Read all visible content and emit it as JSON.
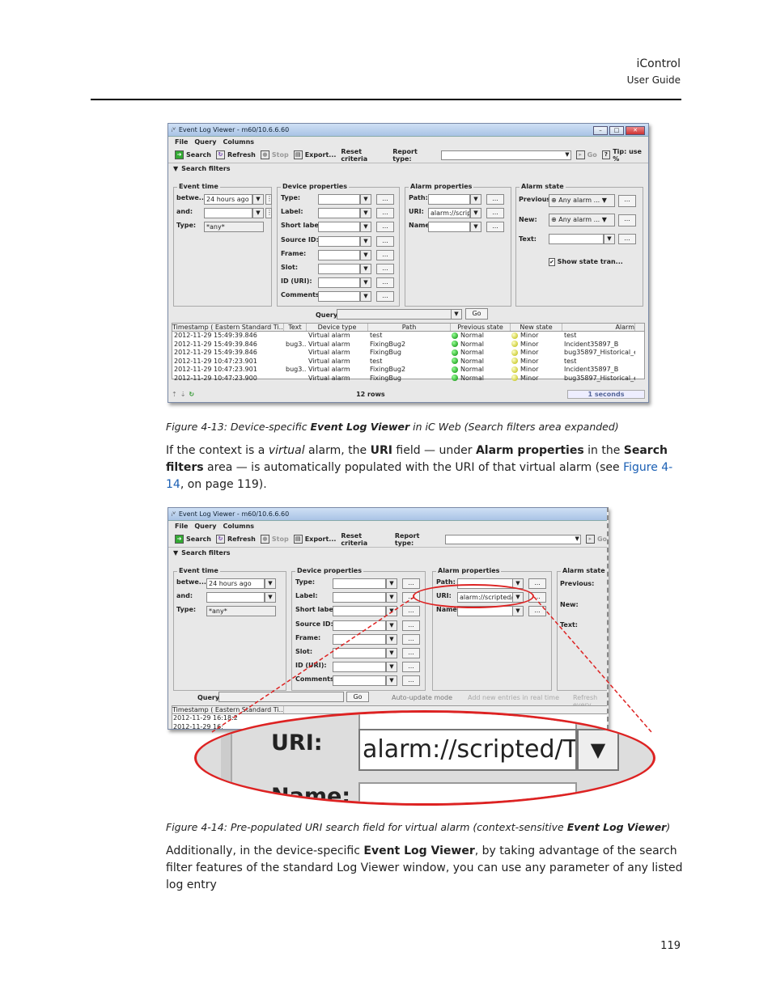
{
  "header": {
    "title": "iControl",
    "subtitle": "User Guide"
  },
  "page_number": "119",
  "fig13": {
    "window_title": "Event Log Viewer - m60/10.6.6.60",
    "menu": [
      "File",
      "Query",
      "Columns"
    ],
    "toolbar": {
      "search": "Search",
      "refresh": "Refresh",
      "stop": "Stop",
      "export": "Export...",
      "reset": "Reset criteria",
      "report_type": "Report type:",
      "go": "Go",
      "tip": "Tip: use %"
    },
    "search_filters": "Search filters",
    "event_time": {
      "title": "Event time",
      "between": "betwe...",
      "between_value": "24 hours ago",
      "and": "and:",
      "type": "Type:",
      "type_value": "*any*"
    },
    "device_properties": {
      "title": "Device properties",
      "labels": [
        "Type:",
        "Label:",
        "Short label:",
        "Source ID:",
        "Frame:",
        "Slot:",
        "ID (URI):",
        "Comments:"
      ]
    },
    "alarm_properties": {
      "title": "Alarm properties",
      "path": "Path:",
      "uri": "URI:",
      "uri_value": "alarm://script",
      "name": "Name:"
    },
    "alarm_state": {
      "title": "Alarm state",
      "previous": "Previous:",
      "new": "New:",
      "text": "Text:",
      "any_alarm": "Any alarm ...",
      "show_state": "Show state tran..."
    },
    "query": "Query:",
    "query_go": "Go",
    "table": {
      "headers": [
        "Timestamp ( Eastern Standard Ti...",
        "Text",
        "Device type",
        "Path",
        "Previous state",
        "New state",
        "Alarm"
      ],
      "rows": [
        [
          "2012-11-29 15:49:39.846",
          "",
          "Virtual alarm",
          "test",
          "Normal",
          "Minor",
          "test"
        ],
        [
          "2012-11-29 15:49:39.846",
          "bug3...",
          "Virtual alarm",
          "FixingBug2",
          "Normal",
          "Minor",
          "Incident35897_B"
        ],
        [
          "2012-11-29 15:49:39.846",
          "",
          "Virtual alarm",
          "FixingBug",
          "Normal",
          "Minor",
          "bug35897_Historical_e"
        ],
        [
          "2012-11-29 10:47:23.901",
          "",
          "Virtual alarm",
          "test",
          "Normal",
          "Minor",
          "test"
        ],
        [
          "2012-11-29 10:47:23.901",
          "bug3...",
          "Virtual alarm",
          "FixingBug2",
          "Normal",
          "Minor",
          "Incident35897_B"
        ],
        [
          "2012-11-29 10:47:23.900",
          "",
          "Virtual alarm",
          "FixingBug",
          "Normal",
          "Minor",
          "bug35897_Historical_e"
        ]
      ]
    },
    "rows_count": "12 rows",
    "elapsed": "1 seconds"
  },
  "caption13": {
    "prefix": "Figure 4-13:  Device-specific ",
    "bold": "Event Log Viewer",
    "suffix": " in iC Web (Search filters area expanded)"
  },
  "para1": {
    "t1": "If the context is a ",
    "t2": "virtual",
    "t3": " alarm, the ",
    "t4": "URI",
    "t5": " field — under ",
    "t6": "Alarm properties",
    "t7": " in the ",
    "t8": "Search filters",
    "t9": " area — is automatically populated with the URI of that virtual alarm (see ",
    "link": "Figure 4-14",
    "t10": ",  on page 119)."
  },
  "fig14": {
    "window_title": "Event Log Viewer - m60/10.6.6.60",
    "uri_value": "alarm://scripted/T",
    "query_extra": {
      "auto_update": "Auto-update mode",
      "add_new": "Add new entries in real time",
      "refresh": "Refresh every"
    },
    "row1": "2012-11-29 16:18:2",
    "row2": "2012-11-29 16:",
    "zoom": {
      "uri": "URI:",
      "value": "alarm://scripted/T",
      "name": "Name:"
    }
  },
  "caption14": {
    "prefix": "Figure 4-14:  Pre-populated URI search field for virtual alarm (context-sensitive ",
    "bold": "Event Log Viewer",
    "suffix": ")"
  },
  "para2": {
    "t1": "Additionally, in the device-specific ",
    "t2": "Event Log Viewer",
    "t3": ", by taking advantage of the search filter features of the standard Log Viewer window, you can use any parameter of any listed log entry"
  }
}
